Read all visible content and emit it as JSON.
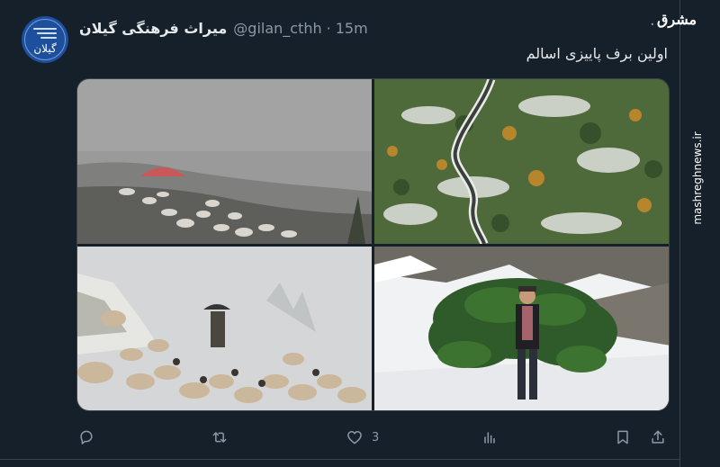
{
  "account": {
    "display_name": "میراث فرهنگی گیلان",
    "handle": "@gilan_cthh",
    "separator": "·",
    "time": "15m",
    "avatar_text": "گیلان"
  },
  "tweet": {
    "text": "اولین برف پاییزی اسالم"
  },
  "media": [
    {
      "icon": "foggy-hillside-sheep-photo"
    },
    {
      "icon": "aerial-forest-road-snow-photo"
    },
    {
      "icon": "snowy-sheep-flock-photo"
    },
    {
      "icon": "man-carrying-branches-snow-photo"
    }
  ],
  "actions": {
    "reply": {
      "icon": "reply-icon"
    },
    "retweet": {
      "icon": "retweet-icon"
    },
    "like": {
      "icon": "heart-icon",
      "count": "3"
    },
    "views": {
      "icon": "analytics-icon"
    },
    "bookmark": {
      "icon": "bookmark-icon"
    },
    "share": {
      "icon": "share-icon"
    }
  },
  "watermark": {
    "logo": "مشرق",
    "url": "mashreghnews.ir"
  },
  "colors": {
    "background": "#15202b",
    "text": "#e7e9ea",
    "muted": "#8b98a5",
    "border": "#38444d",
    "avatar": "#1d4f9c"
  }
}
